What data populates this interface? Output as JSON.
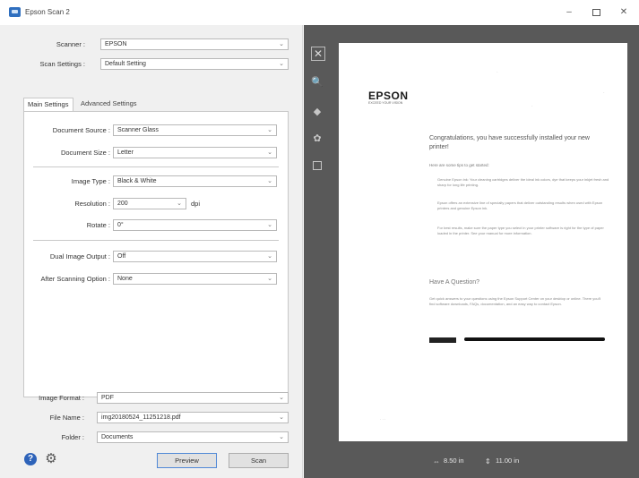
{
  "window": {
    "title": "Epson Scan 2",
    "minimize_glyph": "–",
    "close_glyph": "✕"
  },
  "scanner": {
    "label": "Scanner :",
    "value": "EPSON"
  },
  "scan_settings": {
    "label": "Scan Settings :",
    "value": "Default Setting"
  },
  "tabs": [
    {
      "label": "Main Settings",
      "active": true
    },
    {
      "label": "Advanced Settings",
      "active": false
    }
  ],
  "main_settings": {
    "document_source": {
      "label": "Document Source :",
      "value": "Scanner Glass"
    },
    "document_size": {
      "label": "Document Size :",
      "value": "Letter"
    },
    "image_type": {
      "label": "Image Type :",
      "value": "Black & White"
    },
    "resolution": {
      "label": "Resolution :",
      "value": "200",
      "unit": "dpi"
    },
    "rotate": {
      "label": "Rotate :",
      "value": "0°"
    },
    "dual_image_output": {
      "label": "Dual Image Output :",
      "value": "Off"
    },
    "after_scanning_option": {
      "label": "After Scanning Option :",
      "value": "None"
    }
  },
  "output": {
    "image_format": {
      "label": "Image Format :",
      "value": "PDF"
    },
    "file_name": {
      "label": "File Name :",
      "value": "img20180524_11251218.pdf"
    },
    "folder": {
      "label": "Folder :",
      "value": "Documents"
    }
  },
  "buttons": {
    "help": "?",
    "preview": "Preview",
    "scan": "Scan"
  },
  "preview_tools": {
    "close": "✕",
    "zoom": "🔍",
    "rotate": "◆",
    "adjust": "✿"
  },
  "preview_document": {
    "logo": "EPSON",
    "logo_tagline": "EXCEED YOUR VISION",
    "heading": "Congratulations, you have successfully installed your new printer!",
    "line1": "Here are some tips to get started:",
    "para1": "Genuine Epson ink: Your cleaning cartridges deliver the ideal ink colors, dye that keeps your inkjet fresh and sharp for long life printing.",
    "para2": "Epson offers an extensive line of specialty papers that deliver outstanding results when used with Epson printers and genuine Epson ink.",
    "para3": "For best results, make sure the paper type you select in your printer software is right for the type of paper loaded in the printer. See your manual for more information.",
    "subheading": "Have A Question?",
    "para4": "Get quick answers to your questions using the Epson Support Center on your desktop or online. There you'll find software downloads, FAQs, documentation, and an easy way to contact Epson."
  },
  "size": {
    "width": "8.50 in",
    "height": "11.00 in"
  }
}
